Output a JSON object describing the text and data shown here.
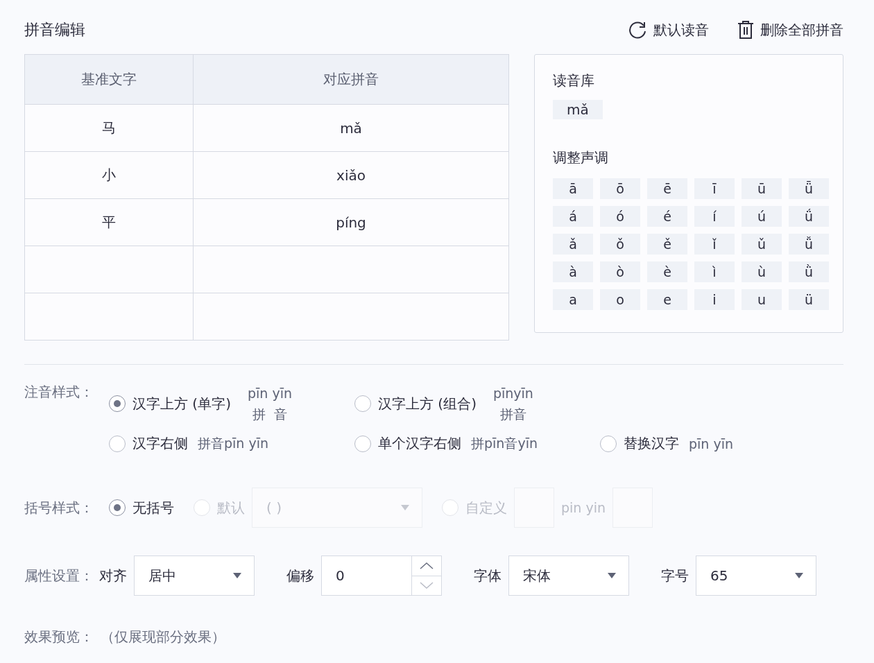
{
  "title": "拼音编辑",
  "actions": [
    {
      "kind": "reset",
      "label": "默认读音"
    },
    {
      "kind": "delete",
      "label": "删除全部拼音"
    }
  ],
  "table": {
    "columns": [
      "基准文字",
      "对应拼音"
    ],
    "rows": [
      {
        "base": "马",
        "pinyin": "mǎ"
      },
      {
        "base": "小",
        "pinyin": "xiǎo"
      },
      {
        "base": "平",
        "pinyin": "píng"
      },
      {},
      {}
    ]
  },
  "library": {
    "title": "读音库",
    "readings": [
      "mǎ"
    ],
    "tone_title": "调整声调",
    "tones": [
      [
        "ā",
        "ō",
        "ē",
        "ī",
        "ū",
        "ǖ"
      ],
      [
        "á",
        "ó",
        "é",
        "í",
        "ú",
        "ǘ"
      ],
      [
        "ǎ",
        "ǒ",
        "ě",
        "ǐ",
        "ǔ",
        "ǚ"
      ],
      [
        "à",
        "ò",
        "è",
        "ì",
        "ù",
        "ǜ"
      ],
      [
        "a",
        "o",
        "e",
        "i",
        "u",
        "ü"
      ]
    ]
  },
  "annotation": {
    "label": "注音样式：",
    "rows": [
      [
        {
          "label": "汉字上方 (单字)",
          "selected": true,
          "kind": "stacked",
          "sample_top": "pīn yīn",
          "sample_bottom": "拼  音"
        },
        {
          "label": "汉字上方 (组合)",
          "selected": false,
          "kind": "stacked",
          "sample_top": "pīnyīn",
          "sample_bottom": "拼音"
        }
      ],
      [
        {
          "label": "汉字右侧",
          "selected": false,
          "kind": "inline",
          "sample": "拼音pīn yīn"
        },
        {
          "label": "单个汉字右侧",
          "selected": false,
          "kind": "inline",
          "sample": "拼pīn音yīn"
        },
        {
          "label": "替换汉字",
          "selected": false,
          "kind": "inline",
          "sample": "pīn yīn"
        }
      ]
    ]
  },
  "brackets": {
    "label": "括号样式：",
    "options": [
      {
        "kind": "plain",
        "label": "无括号",
        "selected": true,
        "disabled": false
      },
      {
        "kind": "select",
        "label": "默认",
        "selected": false,
        "disabled": true,
        "value": "( )"
      },
      {
        "kind": "custom",
        "label": "自定义",
        "selected": false,
        "disabled": true,
        "middle": "pin yin"
      }
    ]
  },
  "properties": {
    "label": "属性设置：",
    "fields": [
      {
        "kind": "select",
        "label": "对齐",
        "value": "居中"
      },
      {
        "kind": "number",
        "label": "偏移",
        "value": "0"
      },
      {
        "kind": "select",
        "label": "字体",
        "value": "宋体"
      },
      {
        "kind": "select",
        "label": "字号",
        "value": "65"
      }
    ]
  },
  "preview": {
    "label": "效果预览：",
    "note": "（仅展现部分效果）"
  }
}
